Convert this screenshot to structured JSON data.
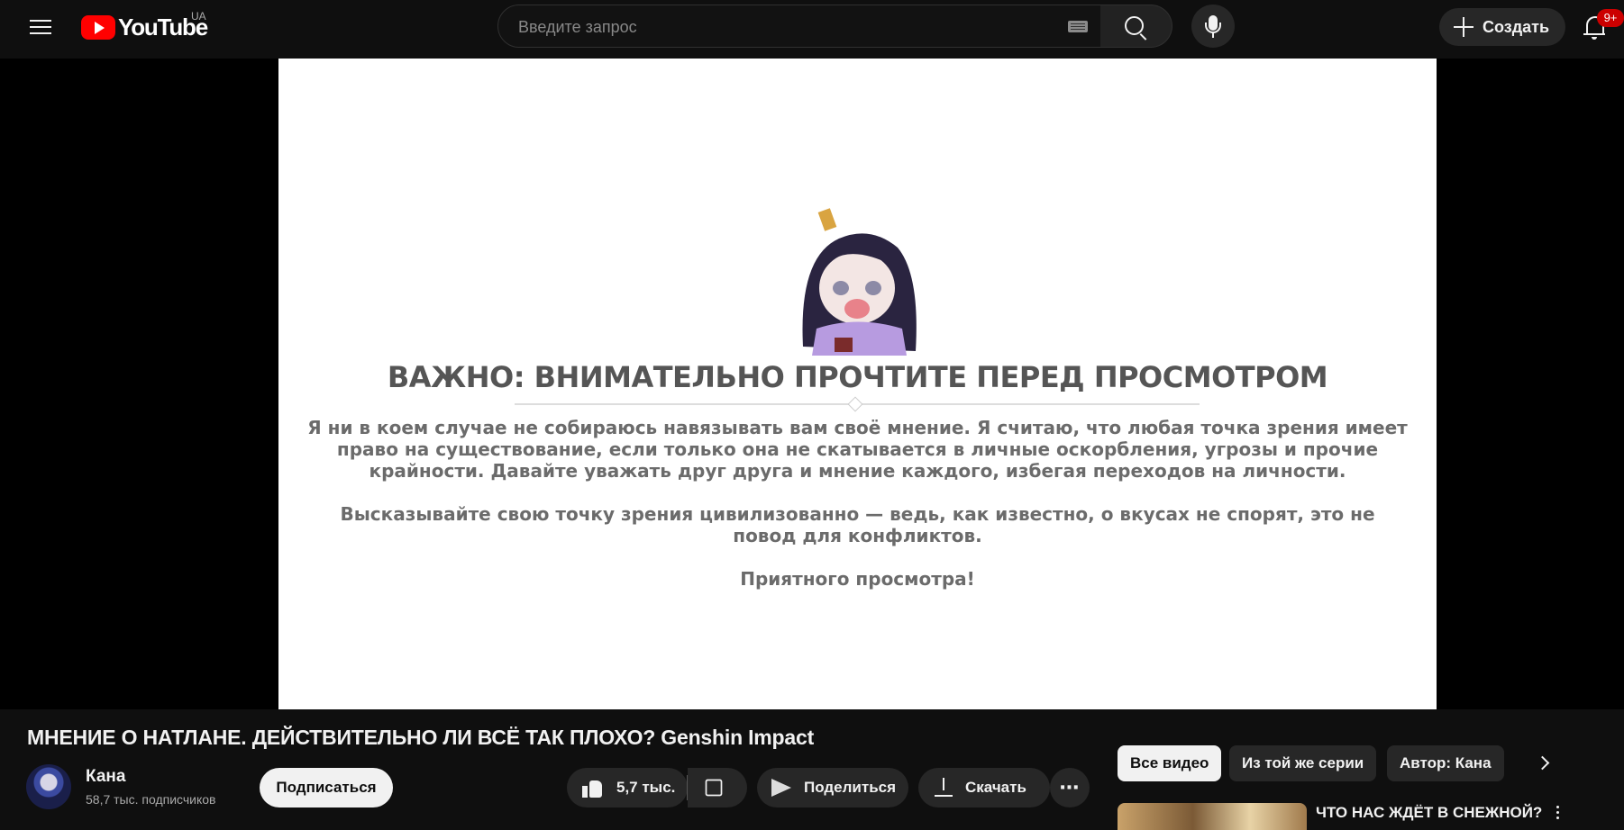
{
  "header": {
    "logo_text": "YouTube",
    "country_code": "UA",
    "search_placeholder": "Введите запрос",
    "create_label": "Создать",
    "notifications_badge": "9+"
  },
  "video": {
    "notice_title": "ВАЖНО: ВНИМАТЕЛЬНО ПРОЧТИТЕ ПЕРЕД ПРОСМОТРОМ",
    "paragraph1": "Я ни в коем случае не собираюсь навязывать вам своё мнение. Я считаю, что любая точка зрения имеет право на существование, если только она не скатывается в личные оскорбления, угрозы и прочие крайности. Давайте уважать друг друга и мнение каждого, избегая переходов на личности.",
    "paragraph2": "Высказывайте свою точку зрения цивилизованно — ведь, как известно, о вкусах не спорят, это не повод для конфликтов.",
    "paragraph3": "Приятного просмотра!"
  },
  "meta": {
    "title": "МНЕНИЕ О НАТЛАНЕ. ДЕЙСТВИТЕЛЬНО ЛИ ВСЁ ТАК ПЛОХО? Genshin Impact",
    "channel_name": "Кана",
    "subscribers": "58,7 тыс. подписчиков",
    "subscribe_label": "Подписаться",
    "like_count": "5,7 тыс.",
    "share_label": "Поделиться",
    "download_label": "Скачать",
    "more_label": "⋯"
  },
  "chips": [
    "Все видео",
    "Из той же серии",
    "Автор: Кана"
  ],
  "recommendation": {
    "title": "ЧТО НАС ЖДЁТ В СНЕЖНОЙ?"
  },
  "colors": {
    "background": "#0f0f0f",
    "brand_red": "#ff0000",
    "badge_red": "#cc0000",
    "pill_bg": "#272727"
  }
}
